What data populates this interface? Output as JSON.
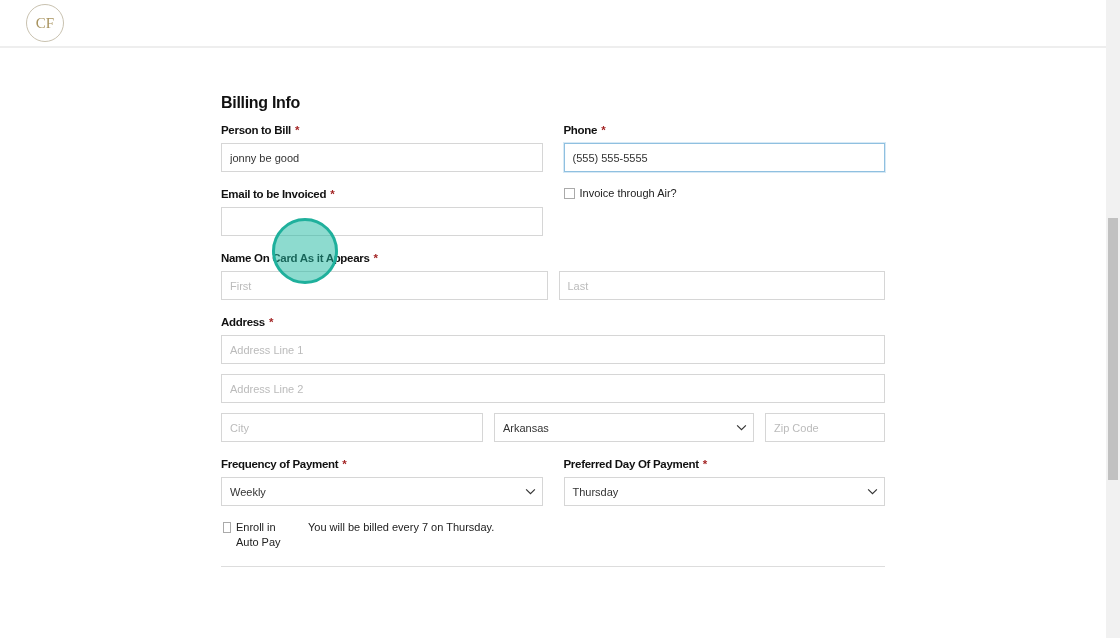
{
  "header": {
    "logo": {
      "monogram": "CF"
    }
  },
  "form": {
    "title": "Billing Info",
    "rows": [
      {
        "kind": "fields",
        "items": [
          {
            "label": "Person to Bill",
            "required_mark": "*",
            "fields": [
              {
                "kind": "text",
                "value": "jonny be good",
                "focused": false
              }
            ]
          },
          {
            "label": "Phone",
            "required_mark": "*",
            "fields": [
              {
                "kind": "text",
                "value": "(555) 555-5555",
                "focused": true
              }
            ]
          }
        ]
      },
      {
        "kind": "fields",
        "items": [
          {
            "label": "Email to be Invoiced",
            "required_mark": "*",
            "fields": [
              {
                "kind": "text",
                "focused": false
              }
            ]
          },
          {
            "kind": "checkbox",
            "label": "Invoice through Air?",
            "checked": false
          }
        ]
      },
      {
        "kind": "fields",
        "items": [
          {
            "label": "Name On Card As it Appears",
            "required_mark": "*",
            "fields": [
              {
                "kind": "text",
                "placeholder": "First",
                "focused": false
              },
              {
                "kind": "text",
                "placeholder": "Last",
                "focused": false
              }
            ]
          }
        ]
      },
      {
        "kind": "address",
        "label": "Address",
        "required_mark": "*",
        "line1": {
          "placeholder": "Address Line 1"
        },
        "line2": {
          "placeholder": "Address Line 2"
        },
        "city": {
          "placeholder": "City"
        },
        "state": {
          "value": "Arkansas"
        },
        "zip": {
          "placeholder": "Zip Code"
        }
      },
      {
        "kind": "fields",
        "items": [
          {
            "label": "Frequency of Payment",
            "required_mark": "*",
            "fields": [
              {
                "kind": "select",
                "value": "Weekly"
              }
            ]
          },
          {
            "label": "Preferred Day Of Payment",
            "required_mark": "*",
            "fields": [
              {
                "kind": "select",
                "value": "Thursday"
              }
            ]
          }
        ]
      },
      {
        "kind": "autopay",
        "checkbox": {
          "label": "Enroll in Auto Pay",
          "checked": false
        },
        "note": "You will be billed every 7 on Thursday."
      }
    ]
  },
  "click_indicator": {
    "visible": true
  }
}
